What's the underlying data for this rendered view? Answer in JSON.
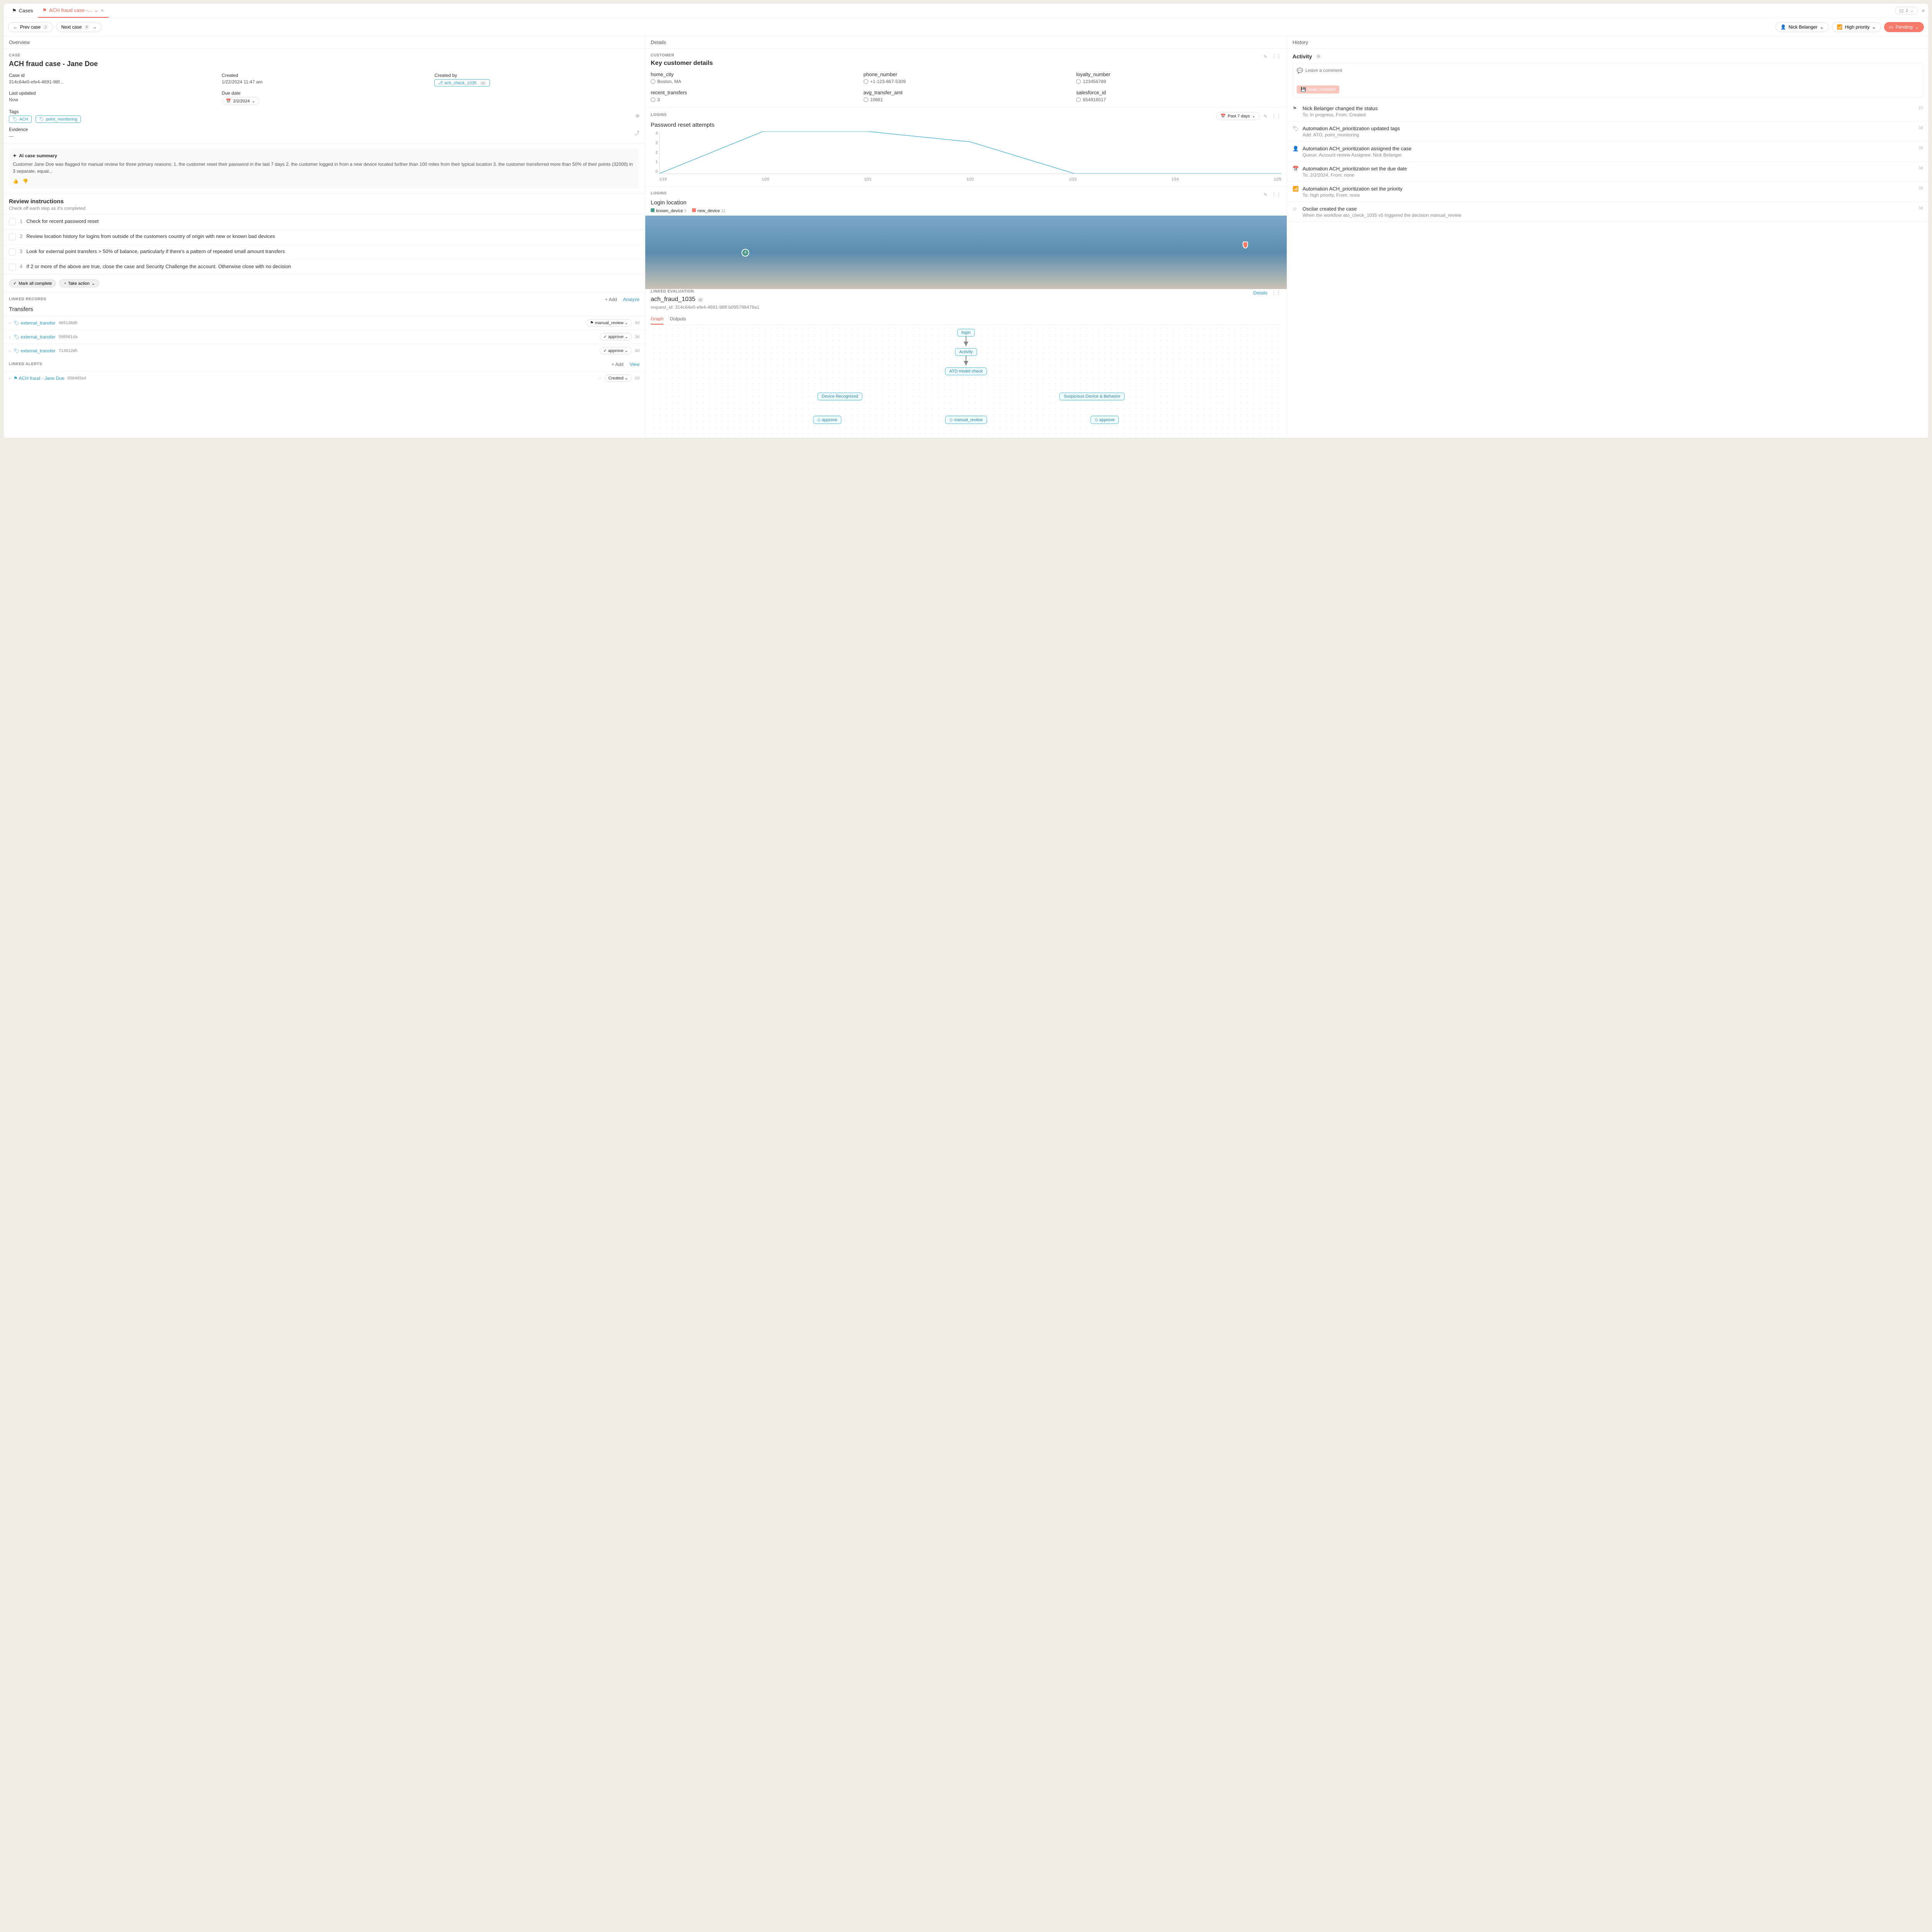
{
  "tabs": {
    "cases": "Cases",
    "active": "ACH fraud case -...",
    "layout_count": "2"
  },
  "nav": {
    "prev": "Prev case",
    "prev_key": "J",
    "next": "Next case",
    "next_key": "K"
  },
  "header_right": {
    "assignee": "Nick Belanger",
    "priority": "High priority",
    "status": "Pending"
  },
  "col_headers": {
    "overview": "Overview",
    "details": "Details",
    "history": "History"
  },
  "case": {
    "label": "CASE",
    "title": "ACH fraud case - Jane Doe",
    "case_id_label": "Case id",
    "case_id": "314c64e0-efe4-4691-98f...",
    "created_label": "Created",
    "created": "1/22/2024 11:47 am",
    "created_by_label": "Created by",
    "created_by": "ach_check_1035",
    "created_by_ver": "v1",
    "last_updated_label": "Last updated",
    "last_updated": "Now",
    "due_label": "Due date",
    "due": "2/2/2024",
    "tags_label": "Tags",
    "tag1": "ACH",
    "tag2": "point_monitoring",
    "evidence_label": "Evidence",
    "evidence_val": "—"
  },
  "ai": {
    "title": "AI case summary",
    "body": "Customer Jane Doe was flagged for manual review for three primary reasons: 1. the customer reset their password in the last 7 days 2. the customer logged in from a new device located further than 100 miles from their typical location 3. the customer transferred more than 50% of their points (32000) in 3 separate, equal..."
  },
  "review": {
    "title": "Review instructions",
    "subtitle": "Check off each step as it's completed",
    "steps": [
      "Check for recent password reset",
      "Review location history for logins from outside of the customers country of origin with new or known bad devices",
      "Look for external point transfers > 50% of balance, particularly if there's a pattern of repeated small amount transfers",
      "If 2 or more of the above are true, close the case and Security Challenge the account. Otherwise close with no decision"
    ],
    "mark_all": "Mark all complete",
    "take_action": "Take action"
  },
  "linked_records": {
    "label": "LINKED RECORDS",
    "add": "Add",
    "analyze": "Analyze",
    "title": "Transfers",
    "rows": [
      {
        "name": "external_transfer",
        "id": "465138d5",
        "decision": "manual_review",
        "age": "3d"
      },
      {
        "name": "external_transfer",
        "id": "5985614a",
        "decision": "approve",
        "age": "3d"
      },
      {
        "name": "external_transfer",
        "id": "713612d5",
        "decision": "approve",
        "age": "3d"
      }
    ]
  },
  "linked_alerts": {
    "label": "LINKED ALERTS",
    "add": "Add",
    "view": "View",
    "rows": [
      {
        "name": "ACH fraud - Jane Doe",
        "id": "956465s4",
        "status": "Created",
        "age": "2d"
      }
    ]
  },
  "customer": {
    "label": "CUSTOMER",
    "title": "Key customer details",
    "fields": [
      {
        "k": "home_city",
        "v": "Boston, MA"
      },
      {
        "k": "phone_number",
        "v": "+1-123-867-5309"
      },
      {
        "k": "loyalty_number",
        "v": "123456789"
      },
      {
        "k": "recent_transfers",
        "v": "3"
      },
      {
        "k": "avg_transfer_amt",
        "v": "10661"
      },
      {
        "k": "salesforce_id",
        "v": "654916517"
      }
    ]
  },
  "logins_chart": {
    "label": "LOGINS",
    "title": "Password reset attempts",
    "range": "Past 7 days"
  },
  "chart_data": {
    "type": "line",
    "title": "Password reset attempts",
    "xlabel": "",
    "ylabel": "",
    "ylim": [
      0,
      4
    ],
    "categories": [
      "1/19",
      "1/20",
      "1/21",
      "1/22",
      "1/23",
      "1/24",
      "1/25"
    ],
    "values": [
      0,
      4,
      4,
      3,
      0,
      0,
      0
    ]
  },
  "login_loc": {
    "label": "LOGINS",
    "title": "Login location",
    "legend": [
      {
        "name": "known_device",
        "count": "5",
        "color": "#4a9b8e"
      },
      {
        "name": "new_device",
        "count": "11",
        "color": "#f87a6b"
      }
    ]
  },
  "linked_eval": {
    "label": "LINKED EVALUATION",
    "details": "Details",
    "name": "ach_fraud_1035",
    "ver": "v5",
    "req_label": "request_id: 314c64e0-efe4-4691-98ff-b095798478a1",
    "tab_graph": "Graph",
    "tab_outputs": "Outputs",
    "nodes": [
      "login",
      "Activity",
      "ATO model check",
      "Device Recognized",
      "Suspicious Device & Behavior",
      "approve",
      "manual_review",
      "approve"
    ]
  },
  "activity": {
    "title": "Activity",
    "count": "6",
    "comment_placeholder": "Leave a comment",
    "save": "Save comment",
    "items": [
      {
        "icon": "flag",
        "title": "Nick Belanger changed the status",
        "sub": "To: In progress, From: Created",
        "time": "1h"
      },
      {
        "icon": "tag",
        "title": "Automation ACH_prioritization updated tags",
        "sub": "Add: ATO, point_monitoring",
        "time": "3d"
      },
      {
        "icon": "user",
        "title": "Automation ACH_prioritization assigned the case",
        "sub": "Queue: Account review Assignee: Nick Belanger",
        "time": "3d"
      },
      {
        "icon": "cal",
        "title": "Automation ACH_prioritization set the due date",
        "sub": "To: 2/2/2024, From: none",
        "time": "3d"
      },
      {
        "icon": "pri",
        "title": "Automation ACH_prioritization set the priority",
        "sub": "To: high priority, From: none",
        "time": "3d"
      },
      {
        "icon": "star",
        "title": "Oscilar created the case",
        "sub": "When the workflow ato_check_1035 v5 triggered the decision manual_review",
        "time": "3d"
      }
    ]
  }
}
